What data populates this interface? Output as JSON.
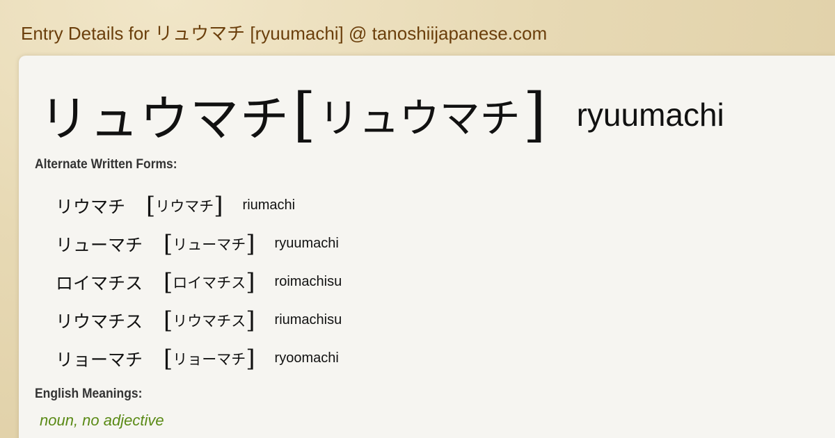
{
  "page_title": "Entry Details for リュウマチ [ryuumachi] @ tanoshiijapanese.com",
  "entry": {
    "word": "リュウマチ",
    "bracket_open": "[",
    "reading": "リュウマチ",
    "bracket_close": "]",
    "romaji": "ryuumachi"
  },
  "alternate_forms": {
    "label": "Alternate Written Forms:",
    "items": [
      {
        "word": "リウマチ",
        "bracket_open": "[",
        "reading": "リウマチ",
        "bracket_close": "]",
        "romaji": "riumachi"
      },
      {
        "word": "リューマチ",
        "bracket_open": "[",
        "reading": "リューマチ",
        "bracket_close": "]",
        "romaji": "ryuumachi"
      },
      {
        "word": "ロイマチス",
        "bracket_open": "[",
        "reading": "ロイマチス",
        "bracket_close": "]",
        "romaji": "roimachisu"
      },
      {
        "word": "リウマチス",
        "bracket_open": "[",
        "reading": "リウマチス",
        "bracket_close": "]",
        "romaji": "riumachisu"
      },
      {
        "word": "リョーマチ",
        "bracket_open": "[",
        "reading": "リョーマチ",
        "bracket_close": "]",
        "romaji": "ryoomachi"
      }
    ]
  },
  "meanings": {
    "label": "English Meanings:",
    "part_of_speech": "noun, no adjective"
  },
  "colors": {
    "header_text": "#6b3f0c",
    "card_background": "#f6f5f1",
    "meaning_text": "#5a8a16"
  }
}
